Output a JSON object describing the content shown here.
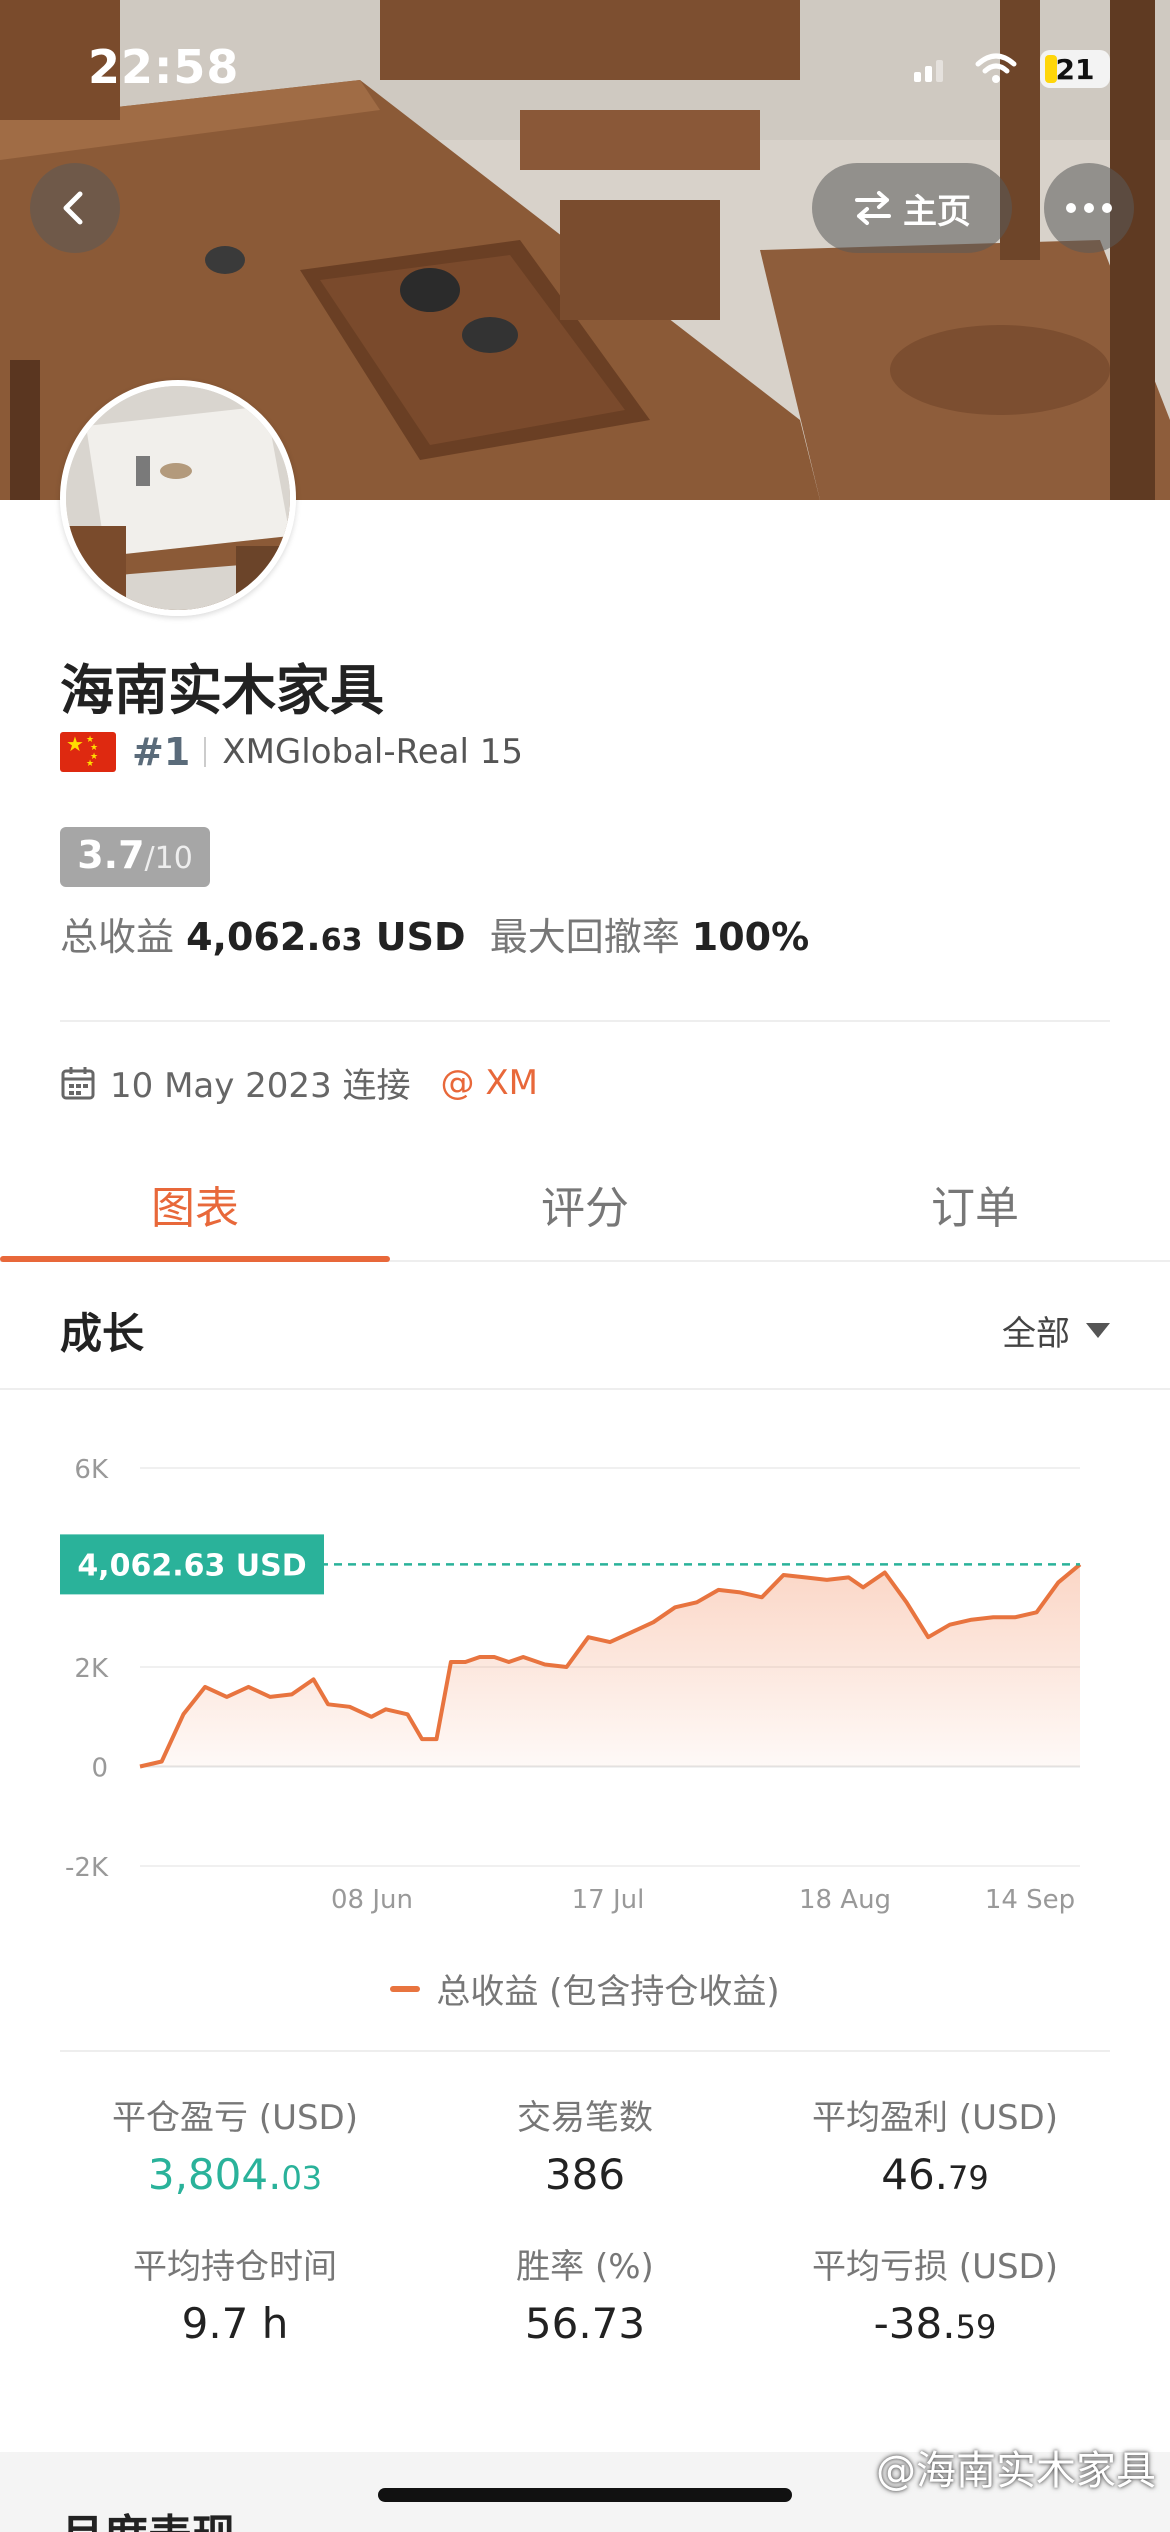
{
  "status_bar": {
    "time": "22:58",
    "battery": "21"
  },
  "nav": {
    "home_label": "主页"
  },
  "profile": {
    "name": "海南实木家具",
    "rank": "#1",
    "server": "XMGlobal-Real 15",
    "score": "3.7",
    "score_max": "/10",
    "total_profit_label": "总收益",
    "total_profit_int": "4,062.",
    "total_profit_dec": "63",
    "total_profit_unit": "USD",
    "max_drawdown_label": "最大回撤率",
    "max_drawdown": "100%",
    "connected_date": "10 May 2023 连接",
    "broker": "@ XM"
  },
  "tabs": [
    {
      "label": "图表",
      "active": true
    },
    {
      "label": "评分",
      "active": false
    },
    {
      "label": "订单",
      "active": false
    }
  ],
  "section": {
    "title": "成长",
    "filter": "全部"
  },
  "chart_data": {
    "type": "area",
    "title": "",
    "y_ticks": [
      "6K",
      "2K",
      "0",
      "-2K"
    ],
    "x_ticks": [
      "08 Jun",
      "17 Jul",
      "18 Aug",
      "14 Sep"
    ],
    "ylim": [
      -2000,
      6000
    ],
    "current_value_label": "4,062.63 USD",
    "current_value": 4062.63,
    "series": [
      {
        "name": "总收益 (包含持仓收益)",
        "color": "#e8743f",
        "x": [
          "2023-05-10",
          "2023-05-13",
          "2023-05-16",
          "2023-05-19",
          "2023-05-22",
          "2023-05-25",
          "2023-05-28",
          "2023-05-31",
          "2023-06-03",
          "2023-06-05",
          "2023-06-08",
          "2023-06-11",
          "2023-06-13",
          "2023-06-16",
          "2023-06-18",
          "2023-06-20",
          "2023-06-22",
          "2023-06-24",
          "2023-06-26",
          "2023-06-28",
          "2023-06-30",
          "2023-07-02",
          "2023-07-05",
          "2023-07-08",
          "2023-07-11",
          "2023-07-14",
          "2023-07-17",
          "2023-07-20",
          "2023-07-23",
          "2023-07-26",
          "2023-07-29",
          "2023-08-01",
          "2023-08-04",
          "2023-08-07",
          "2023-08-10",
          "2023-08-13",
          "2023-08-16",
          "2023-08-18",
          "2023-08-21",
          "2023-08-24",
          "2023-08-27",
          "2023-08-30",
          "2023-09-02",
          "2023-09-05",
          "2023-09-08",
          "2023-09-11",
          "2023-09-14",
          "2023-09-17"
        ],
        "values": [
          0,
          100,
          1050,
          1600,
          1400,
          1600,
          1400,
          1450,
          1750,
          1250,
          1200,
          1000,
          1150,
          1050,
          550,
          550,
          2100,
          2100,
          2200,
          2200,
          2100,
          2200,
          2050,
          2000,
          2600,
          2500,
          2700,
          2900,
          3200,
          3300,
          3550,
          3500,
          3400,
          3850,
          3800,
          3750,
          3800,
          3600,
          3900,
          3300,
          2600,
          2850,
          2950,
          3000,
          3000,
          3100,
          3700,
          4062.63
        ]
      }
    ]
  },
  "metrics": [
    {
      "label": "平仓盈亏 (USD)",
      "int": "3,804.",
      "dec": "03",
      "color": "#2ab29a"
    },
    {
      "label": "交易笔数",
      "int": "386",
      "dec": ""
    },
    {
      "label": "平均盈利 (USD)",
      "int": "46.",
      "dec": "79"
    },
    {
      "label": "平均持仓时间",
      "int": "9.7 h",
      "dec": ""
    },
    {
      "label": "胜率 (%)",
      "int": "56.73",
      "dec": ""
    },
    {
      "label": "平均亏损 (USD)",
      "int": "-38.",
      "dec": "59"
    }
  ],
  "peek": {
    "title": "月度表现"
  },
  "watermark": "@海南实木家具"
}
